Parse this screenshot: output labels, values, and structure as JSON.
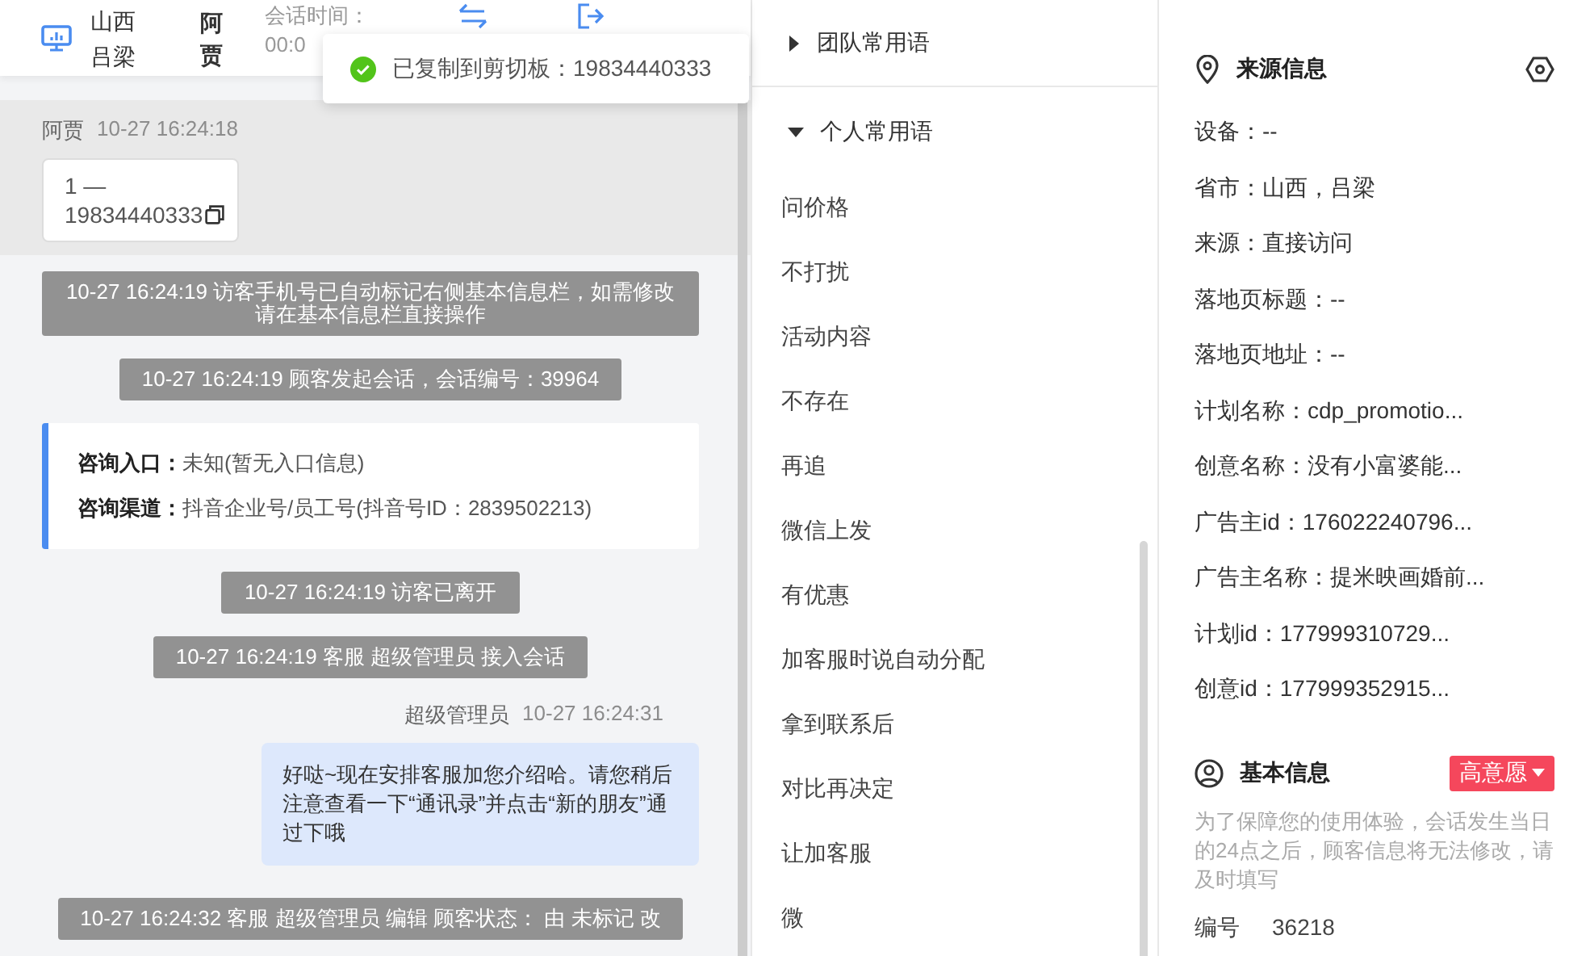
{
  "header": {
    "location": "山西吕梁",
    "visitor": "阿贾",
    "session_label": "会话时间：",
    "session_time": "00:0"
  },
  "toast": {
    "message": "已复制到剪切板：19834440333"
  },
  "messages": [
    {
      "kind": "visitor",
      "sender": "阿贾",
      "time": "10-27 16:24:18",
      "text": "1 — 19834440333",
      "highlighted": true
    },
    {
      "kind": "system",
      "text": "10-27 16:24:19 访客手机号已自动标记右侧基本信息栏，如需修改请在基本信息栏直接操作"
    },
    {
      "kind": "system",
      "text": "10-27 16:24:19 顾客发起会话，会话编号：39964"
    },
    {
      "kind": "info",
      "rows": [
        {
          "label": "咨询入口：",
          "value": "未知(暂无入口信息)"
        },
        {
          "label": "咨询渠道：",
          "value": "抖音企业号/员工号(抖音号ID：2839502213)"
        }
      ]
    },
    {
      "kind": "system",
      "text": "10-27 16:24:19 访客已离开"
    },
    {
      "kind": "system",
      "text": "10-27 16:24:19 客服 超级管理员 接入会话"
    },
    {
      "kind": "agent",
      "sender": "超级管理员",
      "time": "10-27 16:24:31",
      "text": "好哒~现在安排客服加您介绍哈。请您稍后注意查看一下“通讯录”并点击“新的朋友”通过下哦"
    },
    {
      "kind": "system",
      "text": "10-27 16:24:32 客服 超级管理员 编辑 顾客状态： 由 未标记 改"
    }
  ],
  "phrase_groups": [
    {
      "title": "团队常用语",
      "expanded": false
    },
    {
      "title": "个人常用语",
      "expanded": true,
      "items": [
        "问价格",
        "不打扰",
        "活动内容",
        "不存在",
        "再追",
        "微信上发",
        "有优惠",
        "加客服时说自动分配",
        "拿到联系后",
        "对比再决定",
        "让加客服",
        "微"
      ]
    }
  ],
  "source_info": {
    "title": "来源信息",
    "fields": [
      "设备：--",
      "省市：山西，吕梁",
      "来源：直接访问",
      "落地页标题：--",
      "落地页地址：--",
      "计划名称：cdp_promotio...",
      "创意名称：没有小富婆能...",
      "广告主id：176022240796...",
      "广告主名称：提米映画婚前...",
      "计划id：177999310729...",
      "创意id：177999352915..."
    ]
  },
  "basic_info": {
    "title": "基本信息",
    "tag": "高意愿",
    "notice": "为了保障您的使用体验，会话发生当日的24点之后，顾客信息将无法修改，请及时填写",
    "fields": [
      {
        "label": "编号",
        "value": "36218"
      }
    ]
  }
}
